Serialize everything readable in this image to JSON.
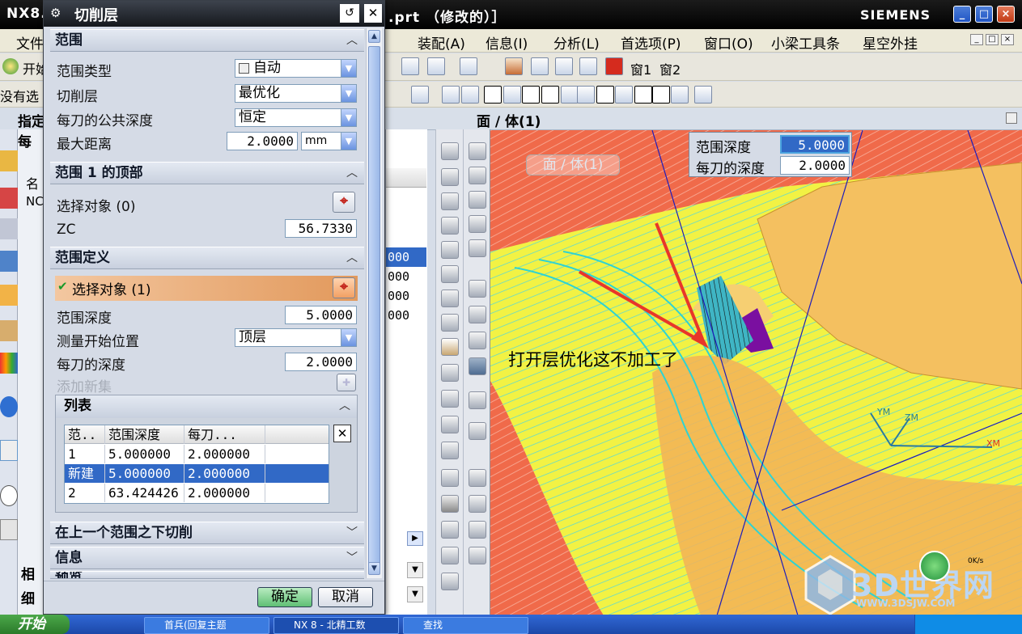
{
  "window": {
    "title": "NX8.",
    "title_suffix": ".prt （修改的）］",
    "brand": "SIEMENS",
    "controls": [
      "_",
      "□",
      "×"
    ]
  },
  "menubar": {
    "items": [
      "文件",
      "装配(A)",
      "信息(I)",
      "分析(L)",
      "首选项(P)",
      "窗口(O)",
      "小梁工具条",
      "星空外挂"
    ]
  },
  "toolbar": {
    "start_label": "开始",
    "no_select_label": "没有选",
    "window_buttons": [
      "窗1",
      "窗2"
    ]
  },
  "selection_bar": {
    "label": "面 / 体(1)"
  },
  "navigator": {
    "header": "名",
    "row0": "NC",
    "side_hint": "指定每",
    "values": [
      "000",
      "000",
      "000",
      "000"
    ],
    "selected_index": 0
  },
  "left_panel": {
    "labels": [
      "相",
      "细"
    ]
  },
  "dialog": {
    "title": "切削层",
    "sections": {
      "range": {
        "title": "范围",
        "range_type_label": "范围类型",
        "range_type_value": "自动",
        "cut_layer_label": "切削层",
        "cut_layer_value": "最优化",
        "common_depth_label": "每刀的公共深度",
        "common_depth_value": "恒定",
        "max_distance_label": "最大距离",
        "max_distance_value": "2.0000",
        "max_distance_unit": "mm"
      },
      "range_top": {
        "title": "范围 1 的顶部",
        "select_object_label": "选择对象 (0)",
        "zc_label": "ZC",
        "zc_value": "56.7330"
      },
      "range_def": {
        "title": "范围定义",
        "select_object_label": "选择对象 (1)",
        "range_depth_label": "范围深度",
        "range_depth_value": "5.0000",
        "measure_start_label": "测量开始位置",
        "measure_start_value": "顶层",
        "depth_per_cut_label": "每刀的深度",
        "depth_per_cut_value": "2.0000",
        "add_new_set_label": "添加新集"
      },
      "list": {
        "title": "列表",
        "columns": [
          "范..",
          "范围深度",
          "每刀..."
        ],
        "rows": [
          [
            "1",
            "5.000000",
            "2.000000"
          ],
          [
            "新建",
            "5.000000",
            "2.000000"
          ],
          [
            "2",
            "63.424426",
            "2.000000"
          ]
        ],
        "selected_row": 1
      },
      "cut_below": {
        "title": "在上一个范围之下切削"
      },
      "info": {
        "title": "信息"
      },
      "preview": {
        "title": "预览"
      }
    },
    "ok_label": "确定",
    "cancel_label": "取消"
  },
  "viewport": {
    "tag_label": "面 / 体(1)",
    "annotation": "打开层优化这不加工了",
    "axis_labels": [
      "YM",
      "ZM",
      "XM"
    ],
    "depth_panel": {
      "range_depth_label": "范围深度",
      "range_depth_value": "5.0000",
      "depth_per_cut_label": "每刀的深度",
      "depth_per_cut_value": "2.0000"
    },
    "watermark": "3D世界网",
    "watermark_url": "WWW.3DSJW.COM",
    "speed_label": "0K/s"
  },
  "taskbar": {
    "start": "开始",
    "tasks": [
      "首兵(回复主题",
      "NX 8 - 北精工数",
      "查找"
    ]
  },
  "colors": {
    "dialog_bg": "#d5dbe6",
    "selected_blue": "#3169c6",
    "model_yellow": "#f4c060",
    "toolpath_cyan": "#38e0e0",
    "surface_yellow": "#f2f244",
    "annotation_red": "#e8362a",
    "accent_orange": "#f0b37a"
  }
}
